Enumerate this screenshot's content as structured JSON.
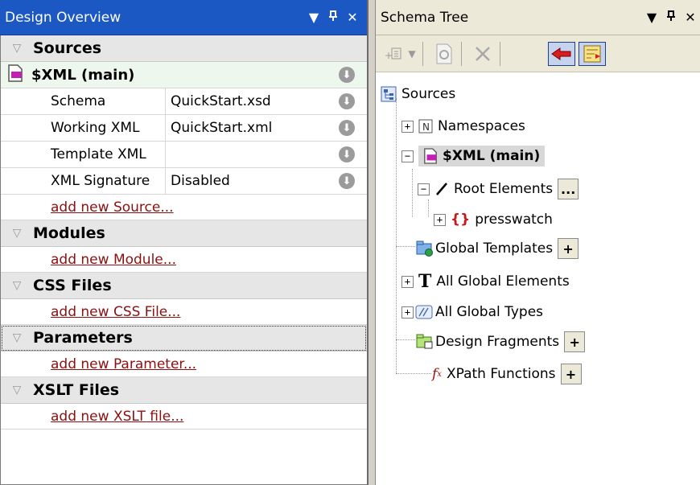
{
  "left_panel": {
    "title": "Design Overview",
    "controls": [
      "dropdown-icon",
      "pin-icon",
      "close-icon"
    ],
    "sections": {
      "sources": {
        "label": "Sources",
        "source_name": "$XML (main)",
        "props": [
          {
            "key": "Schema",
            "value": "QuickStart.xsd"
          },
          {
            "key": "Working XML",
            "value": "QuickStart.xml"
          },
          {
            "key": "Template XML",
            "value": ""
          },
          {
            "key": "XML Signature",
            "value": "Disabled"
          }
        ],
        "add_link": "add new Source..."
      },
      "modules": {
        "label": "Modules",
        "add_link": "add new Module..."
      },
      "css": {
        "label": "CSS Files",
        "add_link": "add new CSS File..."
      },
      "parameters": {
        "label": "Parameters",
        "add_link": "add new Parameter..."
      },
      "xslt": {
        "label": "XSLT Files",
        "add_link": "add new XSLT file..."
      }
    }
  },
  "right_panel": {
    "title": "Schema Tree",
    "controls": [
      "dropdown-icon",
      "pin-icon",
      "close-icon"
    ],
    "toolbar": [
      "add-element-icon",
      "dropdown-arrow-icon",
      "xpath-icon",
      "delete-icon",
      "back-icon",
      "sort-icon"
    ],
    "tree": {
      "root": "Sources",
      "namespaces": "Namespaces",
      "xml_main": "$XML (main)",
      "root_elements": "Root Elements",
      "root_elements_btn": "...",
      "presswatch": "presswatch",
      "global_templates": "Global Templates",
      "all_global_elements": "All Global Elements",
      "all_global_types": "All Global Types",
      "design_fragments": "Design Fragments",
      "xpath_functions": "XPath Functions",
      "plus_btn": "+"
    }
  },
  "colors": {
    "active_title": "#1b58c4",
    "link": "#8c1010",
    "source_row": "#eef7ee",
    "section_header": "#e6e6e6"
  }
}
